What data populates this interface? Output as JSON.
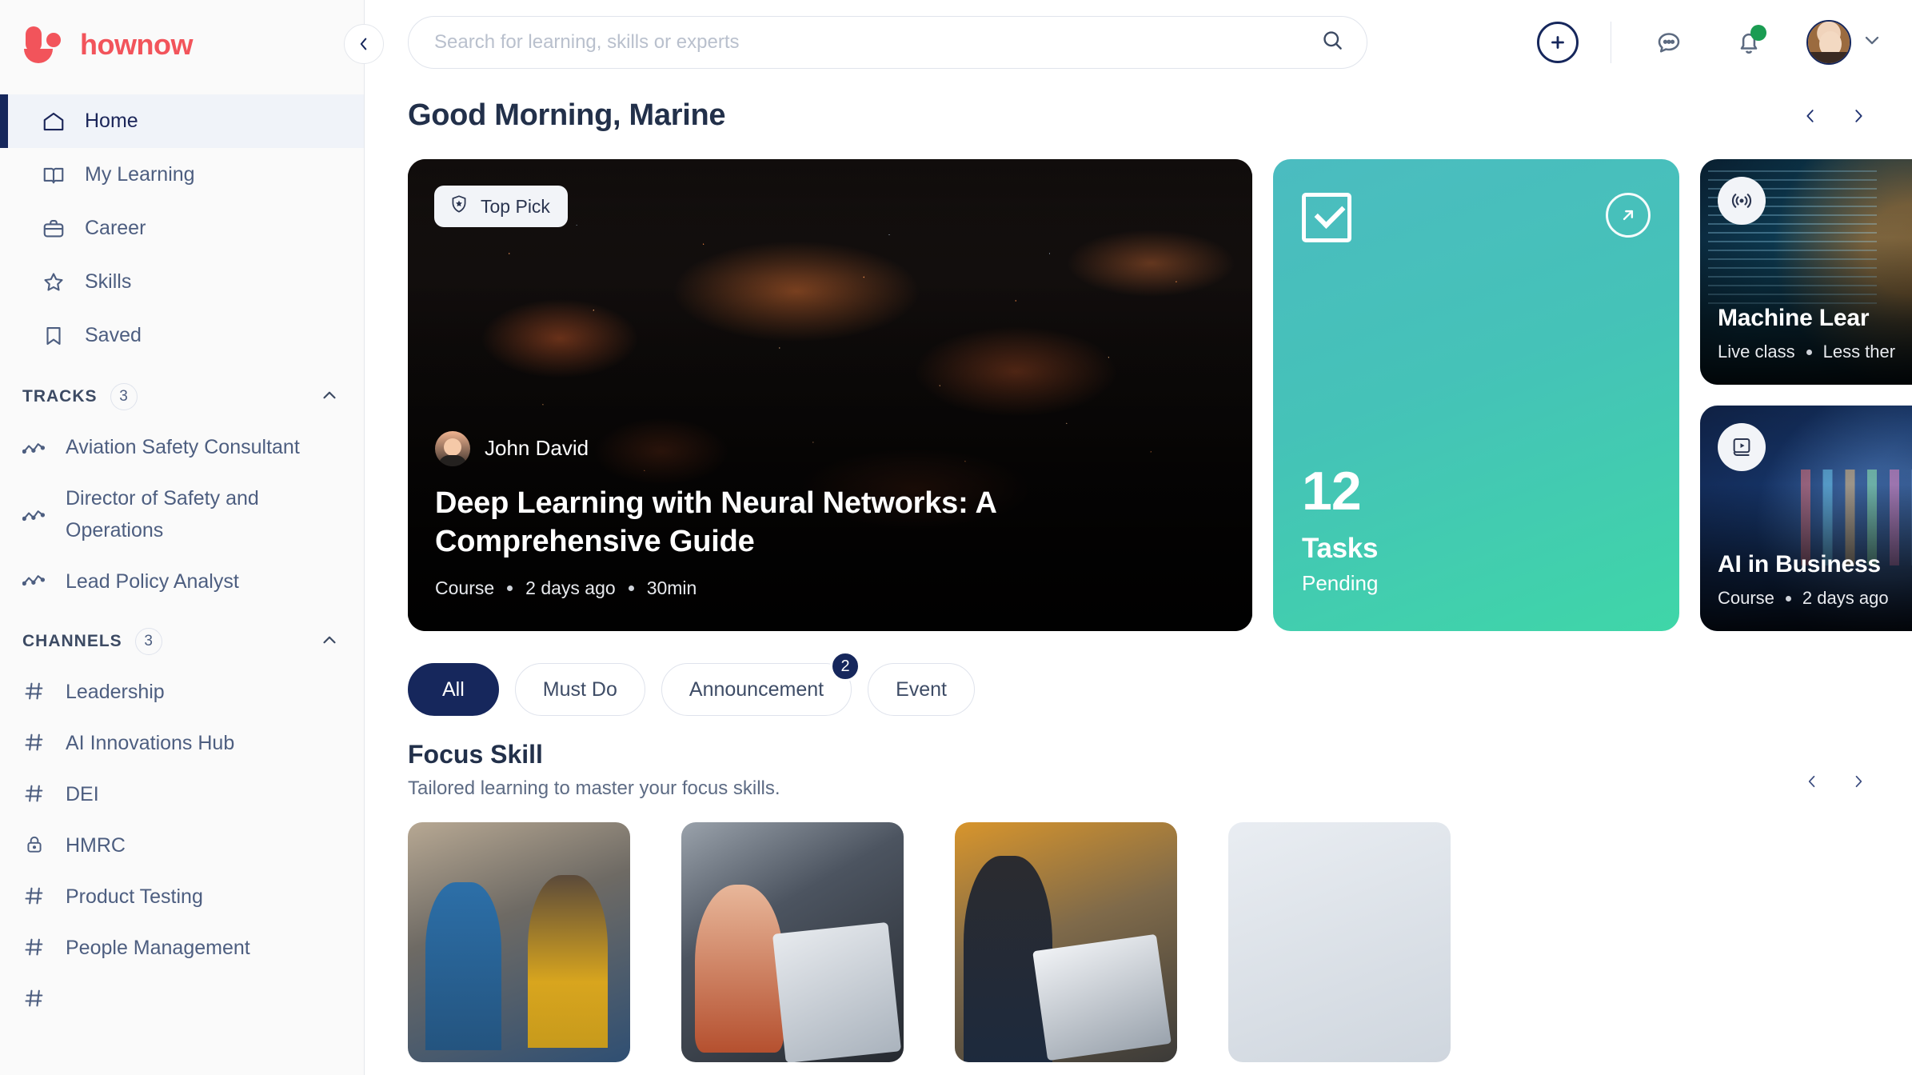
{
  "brand": {
    "name": "hownow"
  },
  "sidebar": {
    "collapse_icon": "chevron-left-icon",
    "nav": [
      {
        "label": "Home",
        "icon": "home-icon",
        "active": true
      },
      {
        "label": "My Learning",
        "icon": "book-icon",
        "active": false
      },
      {
        "label": "Career",
        "icon": "briefcase-icon",
        "active": false
      },
      {
        "label": "Skills",
        "icon": "star-icon",
        "active": false
      },
      {
        "label": "Saved",
        "icon": "bookmark-icon",
        "active": false
      }
    ],
    "tracks": {
      "title": "TRACKS",
      "count": "3",
      "chevron": "chevron-up-icon",
      "items": [
        {
          "label": "Aviation Safety Consultant",
          "icon": "track-line-icon"
        },
        {
          "label": "Director of Safety and Operations",
          "icon": "track-line-icon"
        },
        {
          "label": "Lead Policy Analyst",
          "icon": "track-line-icon"
        }
      ]
    },
    "channels": {
      "title": "CHANNELS",
      "count": "3",
      "chevron": "chevron-up-icon",
      "items": [
        {
          "label": "Leadership",
          "icon": "hash-icon"
        },
        {
          "label": "AI Innovations Hub",
          "icon": "hash-icon"
        },
        {
          "label": "DEI",
          "icon": "hash-icon"
        },
        {
          "label": "HMRC",
          "icon": "lock-icon"
        },
        {
          "label": "Product Testing",
          "icon": "hash-icon"
        },
        {
          "label": "People Management",
          "icon": "hash-icon"
        }
      ]
    }
  },
  "topbar": {
    "search_placeholder": "Search for learning, skills or experts",
    "search_value": "",
    "search_icon": "search-icon",
    "create_icon": "plus-circle-icon",
    "messages_icon": "chat-bubble-icon",
    "notifications_icon": "bell-icon",
    "notification_dot": true,
    "avatar_icon": "user-avatar",
    "avatar_caret": "chevron-down-icon"
  },
  "main": {
    "greeting": "Good Morning, Marine",
    "carousel_prev": "chevron-left-icon",
    "carousel_next": "chevron-right-icon"
  },
  "hero": {
    "badge_label": "Top Pick",
    "badge_icon": "shield-star-icon",
    "author": "John David",
    "title": "Deep Learning with Neural Networks: A Comprehensive Guide",
    "meta": [
      "Course",
      "2 days ago",
      "30min"
    ]
  },
  "tasks_card": {
    "icon": "checkbox-check-icon",
    "launch_icon": "arrow-up-right-icon",
    "count": "12",
    "label": "Tasks",
    "status": "Pending"
  },
  "side_cards": [
    {
      "icon": "broadcast-icon",
      "title": "Machine Lear",
      "meta": [
        "Live class",
        "Less ther"
      ]
    },
    {
      "icon": "video-book-icon",
      "title": "AI in Business",
      "meta": [
        "Course",
        "2 days ago"
      ]
    }
  ],
  "filters": [
    {
      "label": "All",
      "active": true,
      "badge": ""
    },
    {
      "label": "Must Do",
      "active": false,
      "badge": ""
    },
    {
      "label": "Announcement",
      "active": false,
      "badge": "2"
    },
    {
      "label": "Event",
      "active": false,
      "badge": ""
    }
  ],
  "focus": {
    "title": "Focus Skill",
    "subtitle": "Tailored learning to master your focus skills.",
    "prev": "chevron-left-icon",
    "next": "chevron-right-icon",
    "cards": [
      {
        "name": "focus-skill-card-1"
      },
      {
        "name": "focus-skill-card-2"
      },
      {
        "name": "focus-skill-card-3"
      },
      {
        "name": "focus-skill-card-4"
      }
    ]
  },
  "colors": {
    "brand_red": "#f2545b",
    "navy": "#16275c",
    "teal_start": "#4bbcc0",
    "teal_end": "#3fd6a8",
    "sidebar_bg": "#fafafa",
    "notify_green": "#1a9c52"
  }
}
